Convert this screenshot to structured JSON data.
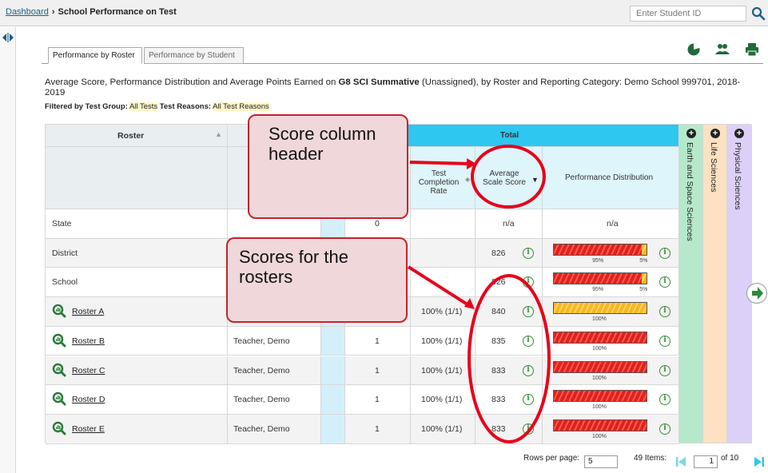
{
  "breadcrumb": {
    "dashboard": "Dashboard",
    "title": "School Performance on Test"
  },
  "search": {
    "placeholder": "Enter Student ID",
    "icon": "search-icon"
  },
  "tabs": [
    "Performance by Roster",
    "Performance by Student"
  ],
  "description": {
    "prefix": "Average Score, Performance Distribution and Average Points Earned on ",
    "test": "G8 SCI Summative",
    "suffix": " (Unassigned), by Roster and Reporting Category: Demo School 999701, 2018-2019"
  },
  "filter": {
    "label1": "Filtered by Test Group:",
    "value1": "All Tests",
    "label2": "Test Reasons:",
    "value2": "All Test Reasons"
  },
  "table": {
    "roster_header": "Roster",
    "total_header": "Total",
    "completion_header": "Test Completion Rate",
    "score_header": "Average Scale Score",
    "dist_header": "Performance Distribution",
    "categories": [
      "Earth and Space Sciences",
      "Life Sciences",
      "Physical Sciences"
    ],
    "rows": [
      {
        "name": "State",
        "teacher": "",
        "count": "0",
        "rate": "",
        "score": "n/a",
        "dist_text": "n/a",
        "link": false,
        "dist": null
      },
      {
        "name": "District",
        "teacher": "",
        "count": "",
        "rate": "",
        "score": "826",
        "dist_text": "",
        "link": false,
        "dist": {
          "red": 95,
          "yellow": 5,
          "labels": [
            "95%",
            "5%"
          ]
        }
      },
      {
        "name": "School",
        "teacher": "",
        "count": "",
        "rate": "",
        "score": "826",
        "dist_text": "",
        "link": false,
        "dist": {
          "red": 95,
          "yellow": 5,
          "labels": [
            "95%",
            "5%"
          ]
        }
      },
      {
        "name": "Roster A",
        "teacher": "",
        "count": "",
        "rate": "100% (1/1)",
        "score": "840",
        "dist_text": "",
        "link": true,
        "dist": {
          "red": 0,
          "yellow": 100,
          "labels": [
            "100%"
          ]
        }
      },
      {
        "name": "Roster B",
        "teacher": "Teacher, Demo",
        "count": "1",
        "rate": "100% (1/1)",
        "score": "835",
        "dist_text": "",
        "link": true,
        "dist": {
          "red": 100,
          "yellow": 0,
          "labels": [
            "100%"
          ]
        }
      },
      {
        "name": "Roster C",
        "teacher": "Teacher, Demo",
        "count": "1",
        "rate": "100% (1/1)",
        "score": "833",
        "dist_text": "",
        "link": true,
        "dist": {
          "red": 100,
          "yellow": 0,
          "labels": [
            "100%"
          ]
        }
      },
      {
        "name": "Roster D",
        "teacher": "Teacher, Demo",
        "count": "1",
        "rate": "100% (1/1)",
        "score": "833",
        "dist_text": "",
        "link": true,
        "dist": {
          "red": 100,
          "yellow": 0,
          "labels": [
            "100%"
          ]
        }
      },
      {
        "name": "Roster E",
        "teacher": "Teacher, Demo",
        "count": "1",
        "rate": "100% (1/1)",
        "score": "833",
        "dist_text": "",
        "link": true,
        "dist": {
          "red": 100,
          "yellow": 0,
          "labels": [
            "100%"
          ]
        }
      }
    ]
  },
  "footer": {
    "rows_label": "Rows per page:",
    "rows_value": "5",
    "items": "49 Items:",
    "page": "1",
    "of": "of 10"
  },
  "callouts": {
    "score_header": "Score column header",
    "scores": "Scores for the rosters"
  },
  "colors": {
    "accent_blue": "#2ec7ef",
    "green_icon": "#3a8a3a",
    "callout_red": "#c4232c",
    "bar_red": "#e02020",
    "bar_yellow": "#f7b71d"
  }
}
